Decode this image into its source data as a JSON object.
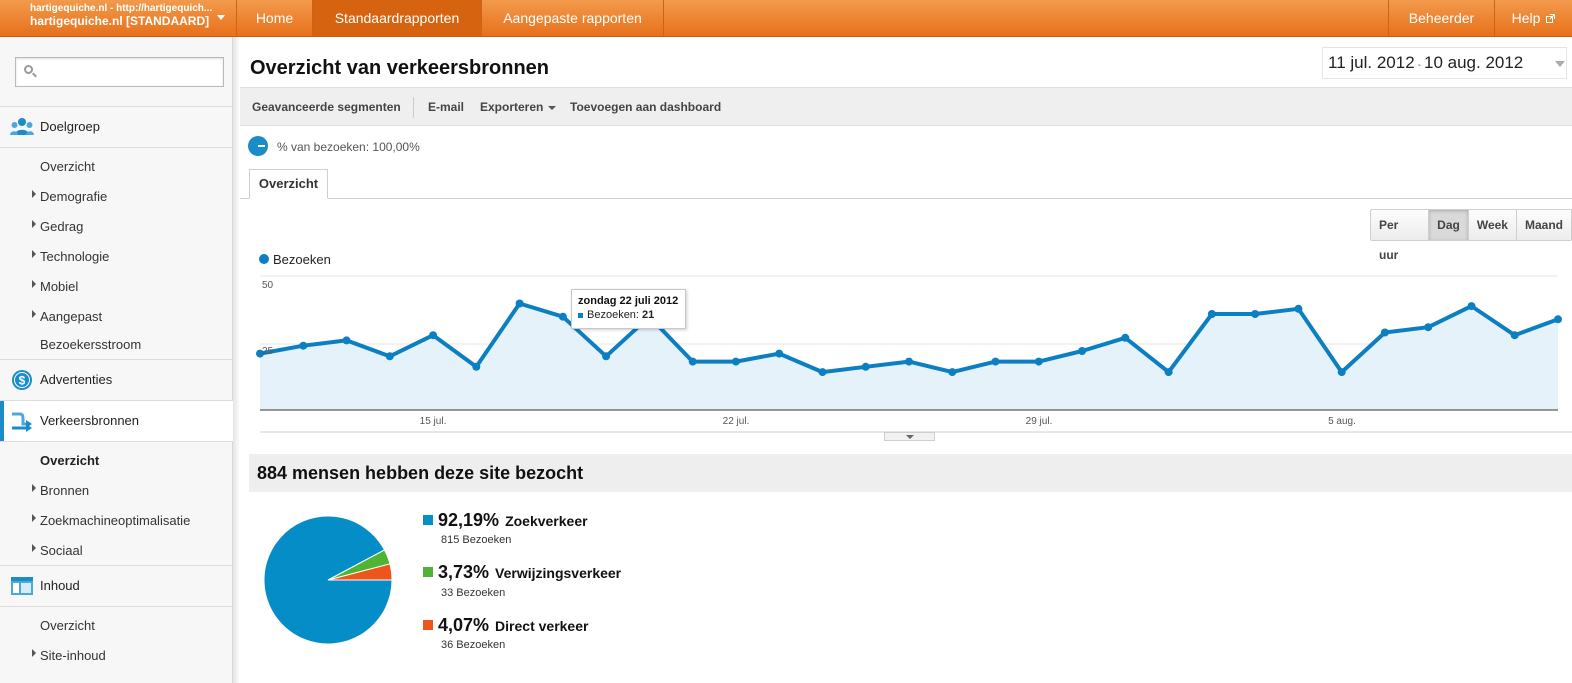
{
  "account": {
    "url": "hartigequiche.nl - http://hartigequich...",
    "property": "hartigequiche.nl [STANDAARD]"
  },
  "nav": {
    "home": "Home",
    "standard_reports": "Standaardrapporten",
    "custom_reports": "Aangepaste rapporten",
    "admin": "Beheerder",
    "help": "Help"
  },
  "sidebar": {
    "search_placeholder": "",
    "audience": {
      "label": "Doelgroep",
      "items": [
        "Overzicht",
        "Demografie",
        "Gedrag",
        "Technologie",
        "Mobiel",
        "Aangepast",
        "Bezoekersstroom"
      ]
    },
    "advertising": {
      "label": "Advertenties"
    },
    "traffic": {
      "label": "Verkeersbronnen",
      "items": [
        "Overzicht",
        "Bronnen",
        "Zoekmachineoptimalisatie",
        "Sociaal"
      ]
    },
    "content": {
      "label": "Inhoud",
      "items": [
        "Overzicht",
        "Site-inhoud"
      ]
    }
  },
  "page": {
    "title": "Overzicht van verkeersbronnen",
    "date_start": "11 jul. 2012",
    "date_sep": "-",
    "date_end": "10 aug. 2012"
  },
  "toolbar": {
    "segments": "Geavanceerde segmenten",
    "email": "E-mail",
    "export": "Exporteren",
    "dashboard": "Toevoegen aan dashboard"
  },
  "segment": {
    "text": "% van bezoeken: 100,00%"
  },
  "tabs": {
    "overview": "Overzicht"
  },
  "granularity": {
    "hour": "Per uur",
    "day": "Dag",
    "week": "Week",
    "month": "Maand",
    "selected": "Dag"
  },
  "chart_data": {
    "type": "area",
    "series": [
      {
        "name": "Bezoeken",
        "color": "#0b7fc2",
        "values": [
          24,
          27,
          29,
          23,
          31,
          19,
          43,
          38,
          23,
          38,
          21,
          21,
          24,
          17,
          19,
          21,
          17,
          21,
          21,
          25,
          30,
          17,
          39,
          39,
          41,
          17,
          32,
          34,
          42,
          31,
          37
        ]
      }
    ],
    "x": [
      "11 jul",
      "12 jul",
      "13 jul",
      "14 jul",
      "15 jul",
      "16 jul",
      "17 jul",
      "18 jul",
      "19 jul",
      "20 jul",
      "21 jul",
      "22 jul",
      "23 jul",
      "24 jul",
      "25 jul",
      "26 jul",
      "27 jul",
      "28 jul",
      "29 jul",
      "30 jul",
      "31 jul",
      "1 aug",
      "2 aug",
      "3 aug",
      "4 aug",
      "5 aug",
      "6 aug",
      "7 aug",
      "8 aug",
      "9 aug",
      "10 aug"
    ],
    "xtick_labels": [
      "15 jul.",
      "22 jul.",
      "29 jul.",
      "5 aug."
    ],
    "ytick_labels": [
      "50",
      "25"
    ],
    "ylim": [
      0,
      50
    ],
    "legend": "Bezoeken",
    "tooltip": {
      "date": "zondag 22 juli 2012",
      "label": "Bezoeken:",
      "value": "21"
    }
  },
  "summary": {
    "headline": "884 mensen hebben deze site bezocht",
    "sources": [
      {
        "pct": "92,19%",
        "name": "Zoekverkeer",
        "visits": "815 Bezoeken",
        "color": "#058dc7",
        "share": 0.9219
      },
      {
        "pct": "3,73%",
        "name": "Verwijzingsverkeer",
        "visits": "33 Bezoeken",
        "color": "#50b432",
        "share": 0.0373
      },
      {
        "pct": "4,07%",
        "name": "Direct verkeer",
        "visits": "36 Bezoeken",
        "color": "#ed561b",
        "share": 0.0407
      }
    ]
  }
}
